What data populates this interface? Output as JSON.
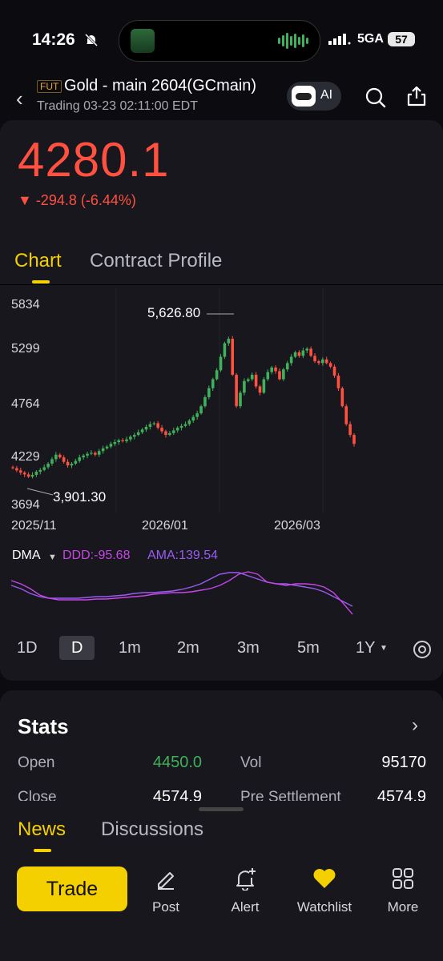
{
  "status_bar": {
    "time": "14:26",
    "network": "5GA",
    "battery": "57"
  },
  "header": {
    "badge": "FUT",
    "title": "Gold - main 2604(GCmain)",
    "subtitle": "Trading 03-23 02:11:00 EDT",
    "ai_label": "AI"
  },
  "quote": {
    "price": "4280.1",
    "change": "▼ -294.8 (-6.44%)",
    "change_color": "#ff5040"
  },
  "tabs": {
    "chart": "Chart",
    "contract_profile": "Contract Profile",
    "active": "Chart"
  },
  "chart_data": {
    "type": "candlestick",
    "y_ticks": [
      "5834",
      "5299",
      "4764",
      "4229",
      "3694"
    ],
    "ylim": [
      3694,
      5834
    ],
    "x_ticks": [
      "2025/11",
      "2026/01",
      "2026/03"
    ],
    "high_annotation": "5,626.80",
    "low_annotation": "3,901.30",
    "up_color": "#3fb15a",
    "down_color": "#ff5040",
    "close_series_approx": [
      4010,
      3985,
      3960,
      3940,
      3915,
      3935,
      3970,
      3990,
      4020,
      4060,
      4110,
      4160,
      4130,
      4080,
      4040,
      4060,
      4090,
      4130,
      4150,
      4170,
      4180,
      4160,
      4200,
      4230,
      4250,
      4280,
      4300,
      4320,
      4310,
      4330,
      4360,
      4380,
      4410,
      4440,
      4470,
      4500,
      4510,
      4460,
      4420,
      4380,
      4400,
      4430,
      4460,
      4480,
      4500,
      4540,
      4580,
      4620,
      4700,
      4800,
      4900,
      5000,
      5100,
      5250,
      5400,
      5450,
      5050,
      4700,
      4850,
      4980,
      5000,
      5050,
      4920,
      4850,
      5000,
      5080,
      5130,
      5090,
      5000,
      5110,
      5180,
      5250,
      5300,
      5260,
      5320,
      5340,
      5260,
      5200,
      5180,
      5220,
      5180,
      5140,
      5040,
      4900,
      4700,
      4500,
      4380,
      4280
    ]
  },
  "indicator": {
    "name": "DMA",
    "ddd": "DDD:-95.68",
    "ama": "AMA:139.54",
    "ddd_color": "#c646e6",
    "ama_color": "#9a5cf0"
  },
  "timeframes": [
    "1D",
    "D",
    "1m",
    "2m",
    "3m",
    "5m",
    "1Y"
  ],
  "timeframe_active": "D",
  "stats": {
    "title": "Stats",
    "rows": [
      {
        "label": "Open",
        "value": "4450.0",
        "value_color": "#3fb15a",
        "label2": "Vol",
        "value2": "95170"
      },
      {
        "label": "Close",
        "value": "4574.9",
        "label2": "Pre Settlement",
        "value2": "4574.9"
      }
    ]
  },
  "bottom": {
    "news_tab": "News",
    "discussions_tab": "Discussions",
    "trade_label": "Trade",
    "nav": [
      {
        "label": "Post",
        "icon": "pencil-icon"
      },
      {
        "label": "Alert",
        "icon": "bell-plus-icon"
      },
      {
        "label": "Watchlist",
        "icon": "heart-icon"
      },
      {
        "label": "More",
        "icon": "grid-icon"
      }
    ]
  }
}
